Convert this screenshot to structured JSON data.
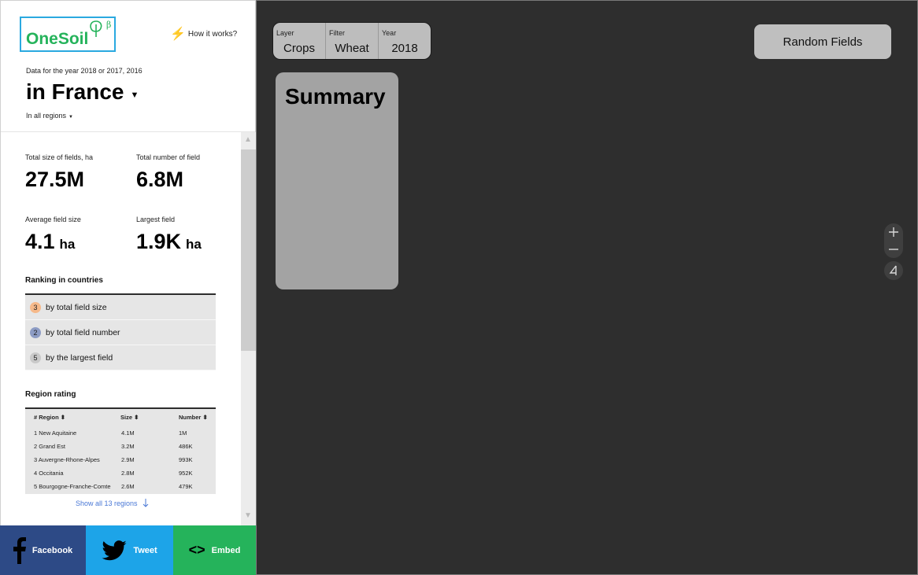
{
  "brand": {
    "logo_text": "OneSoil",
    "beta": "β"
  },
  "header": {
    "how_it_works": "How it works?",
    "data_year": "Data for the year 2018 or 2017, 2016",
    "country": "in France",
    "regions": "In all regions"
  },
  "stats": {
    "total_size_label": "Total size of fields, ha",
    "total_size_value": "27.5M",
    "total_number_label": "Total number of field",
    "total_number_value": "6.8M",
    "avg_size_label": "Average field size",
    "avg_size_value": "4.1",
    "avg_size_unit": "ha",
    "largest_label": "Largest field",
    "largest_value": "1.9K",
    "largest_unit": "ha"
  },
  "ranking": {
    "title": "Ranking in countries",
    "items": [
      {
        "rank": "3",
        "label": "by total field size",
        "color": "#f6b98a"
      },
      {
        "rank": "2",
        "label": "by total field number",
        "color": "#8d9cc4"
      },
      {
        "rank": "5",
        "label": "by the largest field",
        "color": "#c9c9c9"
      }
    ]
  },
  "region_rating": {
    "title": "Region rating",
    "headers": {
      "region": "# Region",
      "size": "Size",
      "number": "Number",
      "sort_glyph": "⬍"
    },
    "rows": [
      {
        "name": "1 New Aquitaine",
        "size": "4.1M",
        "number": "1M"
      },
      {
        "name": "2 Grand Est",
        "size": "3.2M",
        "number": "486K"
      },
      {
        "name": "3 Auvergne-Rhone-Alpes",
        "size": "2.9M",
        "number": "993K"
      },
      {
        "name": "4 Occitania",
        "size": "2.8M",
        "number": "952K"
      },
      {
        "name": "5 Bourgogne-Franche-Comte",
        "size": "2.6M",
        "number": "479K"
      }
    ],
    "show_all": "Show all 13 regions"
  },
  "share": {
    "facebook": "Facebook",
    "tweet": "Tweet",
    "embed": "Embed",
    "embed_glyph": "<>"
  },
  "map": {
    "layer_label": "Layer",
    "layer_value": "Crops",
    "filter_label": "Filter",
    "filter_value": "Wheat",
    "year_label": "Year",
    "year_value": "2018",
    "random_fields": "Random Fields",
    "summary_title": "Summary",
    "zoom_in": "+",
    "zoom_out": "−"
  },
  "colors": {
    "map_bg": "#2e2e2e",
    "brand_green": "#25b35b",
    "logo_border": "#2aa9e0",
    "facebook": "#2d4a86",
    "twitter": "#1da4e8",
    "embed": "#25b35b",
    "link": "#4a78d6"
  }
}
